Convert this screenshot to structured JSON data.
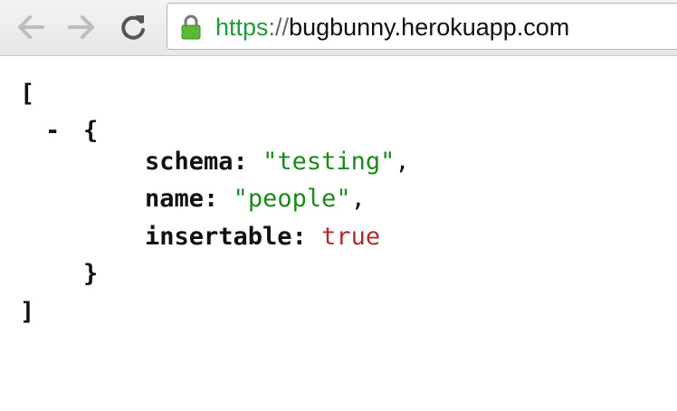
{
  "browser": {
    "url_scheme": "https",
    "url_separator": "://",
    "url_host": "bugbunny.herokuapp.com"
  },
  "json_view": {
    "open_bracket": "[",
    "collapse_toggle": "-",
    "open_brace": "{",
    "rows": [
      {
        "key": "schema",
        "colon": ":",
        "value": "\"testing\"",
        "comma": ",",
        "value_type": "string"
      },
      {
        "key": "name",
        "colon": ":",
        "value": "\"people\"",
        "comma": ",",
        "value_type": "string"
      },
      {
        "key": "insertable",
        "colon": ":",
        "value": "true",
        "comma": "",
        "value_type": "boolean"
      }
    ],
    "close_brace": "}",
    "close_bracket": "]"
  },
  "colors": {
    "string": "#1b8a1b",
    "boolean": "#b22a2a",
    "url_scheme": "#1e9c36"
  },
  "icons": [
    "back-arrow-icon",
    "forward-arrow-icon",
    "reload-icon",
    "lock-icon"
  ]
}
